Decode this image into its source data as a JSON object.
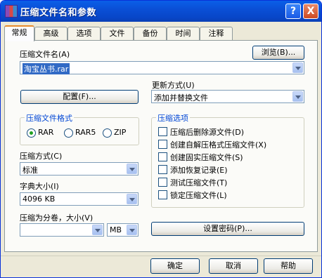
{
  "window": {
    "title": "压缩文件名和参数",
    "help_label": "?",
    "close_label": "X"
  },
  "tabs": [
    "常规",
    "高级",
    "选项",
    "文件",
    "备份",
    "时间",
    "注释"
  ],
  "active_tab": "常规",
  "general": {
    "archive_name_label": "压缩文件名(A)",
    "archive_name_value": "淘宝丛书.rar",
    "browse_label": "浏览(B)...",
    "profiles_label": "配置(F)...",
    "update_mode_label": "更新方式(U)",
    "update_mode_value": "添加并替换文件",
    "format_group_label": "压缩文件格式",
    "formats": [
      {
        "label": "RAR",
        "selected": true
      },
      {
        "label": "RAR5",
        "selected": false
      },
      {
        "label": "ZIP",
        "selected": false
      }
    ],
    "options_group_label": "压缩选项",
    "options": [
      {
        "label": "压缩后删除源文件(D)",
        "checked": false
      },
      {
        "label": "创建自解压格式压缩文件(X)",
        "checked": false
      },
      {
        "label": "创建固实压缩文件(S)",
        "checked": false
      },
      {
        "label": "添加恢复记录(E)",
        "checked": false
      },
      {
        "label": "测试压缩文件(T)",
        "checked": false
      },
      {
        "label": "锁定压缩文件(L)",
        "checked": false
      }
    ],
    "method_label": "压缩方式(C)",
    "method_value": "标准",
    "dict_label": "字典大小(I)",
    "dict_value": "4096 KB",
    "split_label": "压缩为分卷，大小(V)",
    "split_value": "",
    "split_unit": "MB",
    "password_label": "设置密码(P)..."
  },
  "footer": {
    "ok_label": "确定",
    "cancel_label": "取消",
    "help_label": "帮助"
  },
  "colors": {
    "title_bar": "#0a4fd6",
    "group_label": "#0046d5",
    "selection": "#316ac5",
    "tab_accent": "#e68b2c"
  }
}
